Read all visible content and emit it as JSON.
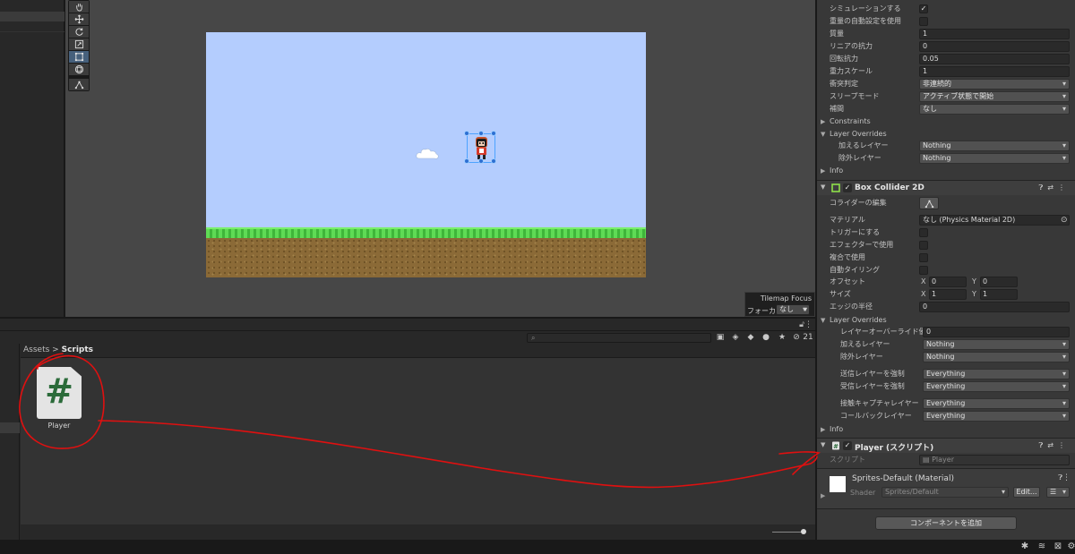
{
  "project": {
    "breadcrumb": {
      "root": "Assets",
      "sep": ">",
      "current": "Scripts"
    },
    "search_placeholder": "",
    "hidden_count": "21",
    "assets": [
      {
        "name": "Player",
        "glyph": "#"
      }
    ]
  },
  "tilemap_focus": {
    "title": "Tilemap Focus",
    "label": "フォーカス",
    "value": "なし"
  },
  "inspector": {
    "rigidbody": {
      "simulate": {
        "label": "シミュレーションする",
        "checked": "✓"
      },
      "auto_mass": {
        "label": "重量の自動設定を使用"
      },
      "mass": {
        "label": "質量",
        "value": "1"
      },
      "linear_drag": {
        "label": "リニアの抗力",
        "value": "0"
      },
      "angular_drag": {
        "label": "回転抗力",
        "value": "0.05"
      },
      "gravity_scale": {
        "label": "重力スケール",
        "value": "1"
      },
      "collision_detection": {
        "label": "衝突判定",
        "value": "非連続的"
      },
      "sleep_mode": {
        "label": "スリープモード",
        "value": "アクティブ状態で開始"
      },
      "interpolate": {
        "label": "補間",
        "value": "なし"
      },
      "constraints": "Constraints",
      "layer_overrides": "Layer Overrides",
      "include_layers": {
        "label": "加えるレイヤー",
        "value": "Nothing"
      },
      "exclude_layers": {
        "label": "除外レイヤー",
        "value": "Nothing"
      },
      "info": "Info"
    },
    "box_collider": {
      "title": "Box Collider 2D",
      "enabled": "✓",
      "edit_collider": {
        "label": "コライダーの編集"
      },
      "material": {
        "label": "マテリアル",
        "value": "なし (Physics Material 2D)"
      },
      "is_trigger": {
        "label": "トリガーにする"
      },
      "used_by_effector": {
        "label": "エフェクターで使用"
      },
      "used_by_composite": {
        "label": "複合で使用"
      },
      "auto_tiling": {
        "label": "自動タイリング"
      },
      "offset": {
        "label": "オフセット",
        "x_label": "X",
        "x": "0",
        "y_label": "Y",
        "y": "0"
      },
      "size": {
        "label": "サイズ",
        "x_label": "X",
        "x": "1",
        "y_label": "Y",
        "y": "1"
      },
      "edge_radius": {
        "label": "エッジの半径",
        "value": "0"
      },
      "layer_overrides": "Layer Overrides",
      "layer_override_priority": {
        "label": "レイヤーオーバーライド優先度",
        "value": "0"
      },
      "include_layers": {
        "label": "加えるレイヤー",
        "value": "Nothing"
      },
      "exclude_layers": {
        "label": "除外レイヤー",
        "value": "Nothing"
      },
      "force_send_layers": {
        "label": "送信レイヤーを強制",
        "value": "Everything"
      },
      "force_receive_layers": {
        "label": "受信レイヤーを強制",
        "value": "Everything"
      },
      "contact_capture_layers": {
        "label": "接触キャプチャレイヤー",
        "value": "Everything"
      },
      "callback_layers": {
        "label": "コールバックレイヤー",
        "value": "Everything"
      },
      "info": "Info"
    },
    "player_script": {
      "title": "Player (スクリプト)",
      "enabled": "✓",
      "script": {
        "label": "スクリプト",
        "value": "Player"
      }
    },
    "material": {
      "title": "Sprites-Default (Material)",
      "shader_label": "Shader",
      "shader_value": "Sprites/Default",
      "edit_label": "Edit...",
      "list_icon": "☰"
    },
    "add_component": "コンポーネントを追加"
  },
  "colors": {
    "annotation": "#e01010",
    "scene_bg": "#474747",
    "sky": "#b4cdfe",
    "inspector_bg": "#383838"
  }
}
